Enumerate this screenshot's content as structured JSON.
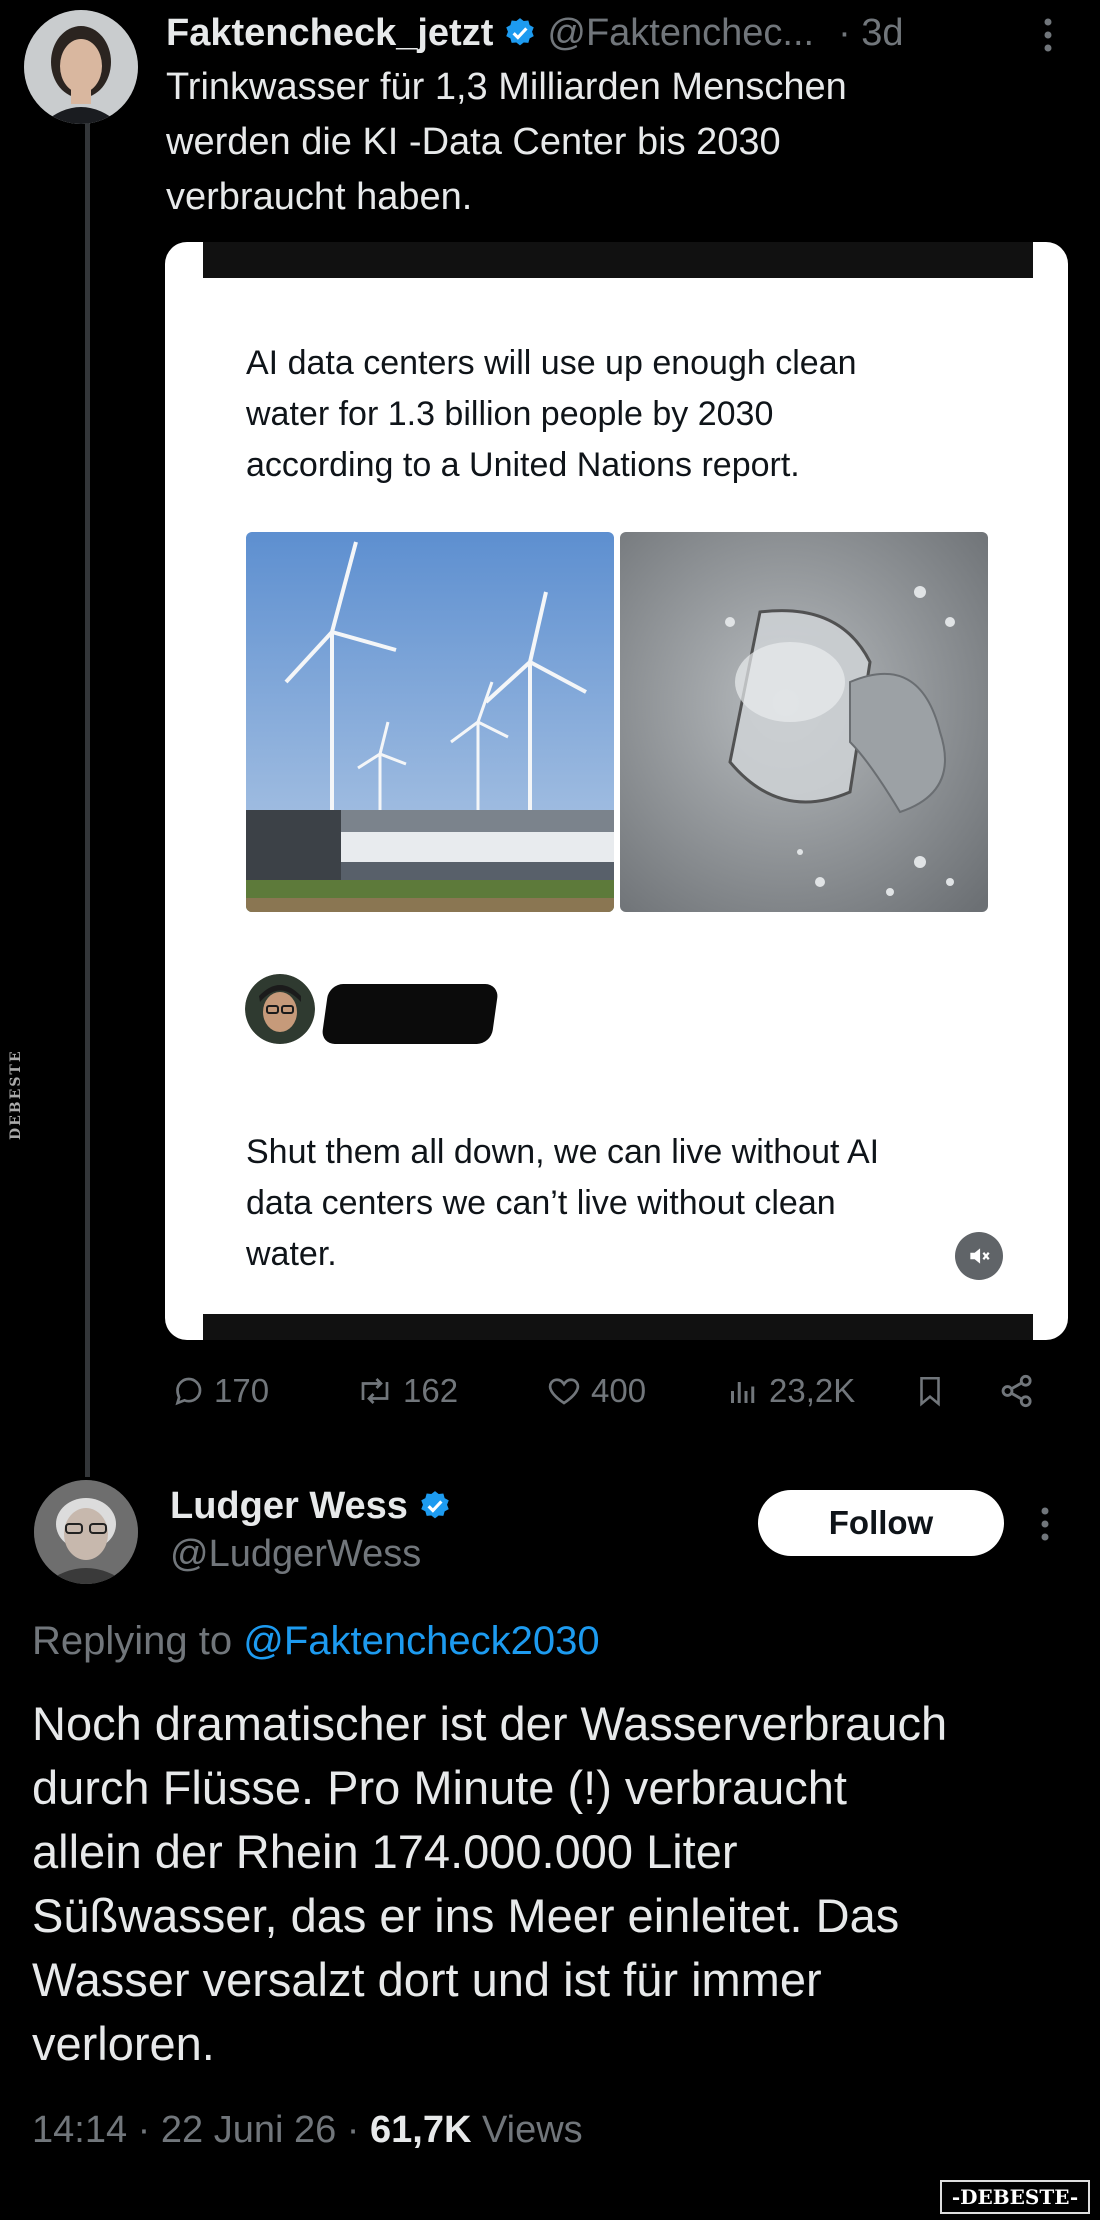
{
  "original_tweet": {
    "display_name": "Faktencheck_jetzt",
    "handle": "@Faktenchec...",
    "time": "· 3d",
    "text_lines": [
      "Trinkwasser für 1,3 Milliarden Menschen",
      "werden die KI -Data Center bis 2030",
      "verbraucht haben."
    ],
    "embed": {
      "text_lines": [
        "AI data centers will use up enough clean",
        "water for 1.3 billion people by 2030",
        "according to a United Nations report."
      ],
      "reply_lines": [
        "Shut them all down, we can live without AI",
        "data centers we can’t live without clean",
        "water."
      ]
    },
    "stats": {
      "replies": "170",
      "reposts": "162",
      "likes": "400",
      "views": "23,2K"
    }
  },
  "reply_tweet": {
    "display_name": "Ludger Wess",
    "handle": "@LudgerWess",
    "follow_label": "Follow",
    "replying_to_prefix": "Replying to",
    "replying_to_handle": "@Faktencheck2030",
    "text_lines": [
      "Noch dramatischer ist der Wasserverbrauch",
      "durch Flüsse. Pro Minute (!) verbraucht",
      "allein der Rhein 174.000.000 Liter",
      "Süßwasser, das er ins Meer einleitet. Das",
      "Wasser versalzt dort und ist für immer",
      "verloren."
    ],
    "timestamp": "14:14 · 22 Juni 26 ·",
    "views_count": "61,7K",
    "views_label": "Views"
  },
  "watermarks": {
    "side": "DEBESTE",
    "corner": "-DEBESTE-"
  },
  "colors": {
    "background": "#000000",
    "text": "#e7e9ea",
    "muted": "#71767b",
    "link": "#1d9bf0",
    "verified": "#1d9bf0"
  }
}
